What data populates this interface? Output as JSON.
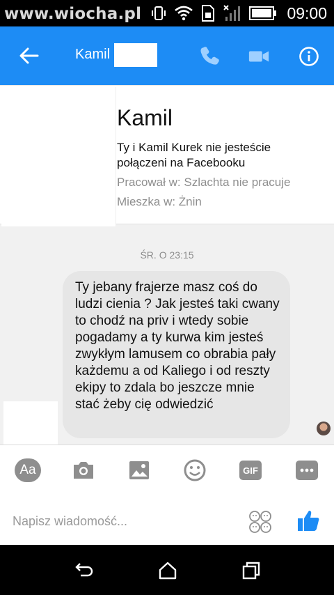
{
  "status_bar": {
    "watermark": "www.wiocha.pl",
    "time": "09:00"
  },
  "header": {
    "contact_name": "Kamil",
    "accent_color": "#1d8cf5",
    "icons": [
      "back-arrow-icon",
      "phone-icon",
      "video-icon",
      "info-icon"
    ]
  },
  "profile": {
    "name": "Kamil",
    "connection_text": "Ty i Kamil Kurek nie jesteście połączeni na Facebooku",
    "work": "Pracował w: Szlachta nie pracuje",
    "lives": "Mieszka w: Żnin"
  },
  "conversation": {
    "timestamp": "ŚR. O 23:15",
    "messages": [
      {
        "text": "Ty jebany frajerze masz coś do ludzi cienia ?  Jak jesteś taki cwany to chodź na priv i wtedy sobie pogadamy a ty kurwa kim jesteś zwykłym lamusem co obrabia pały  każdemu a od Kaliego i od reszty ekipy to zdala bo jeszcze mnie stać żeby cię odwiedzić"
      }
    ]
  },
  "composer": {
    "tools": [
      "text-format-icon",
      "camera-icon",
      "image-icon",
      "emoji-icon",
      "gif-icon",
      "more-icon"
    ],
    "aa_label": "Aa",
    "gif_label": "GIF",
    "placeholder": "Napisz wiadomość..."
  },
  "nav": {
    "icons": [
      "back-nav-icon",
      "home-nav-icon",
      "recents-nav-icon"
    ]
  }
}
